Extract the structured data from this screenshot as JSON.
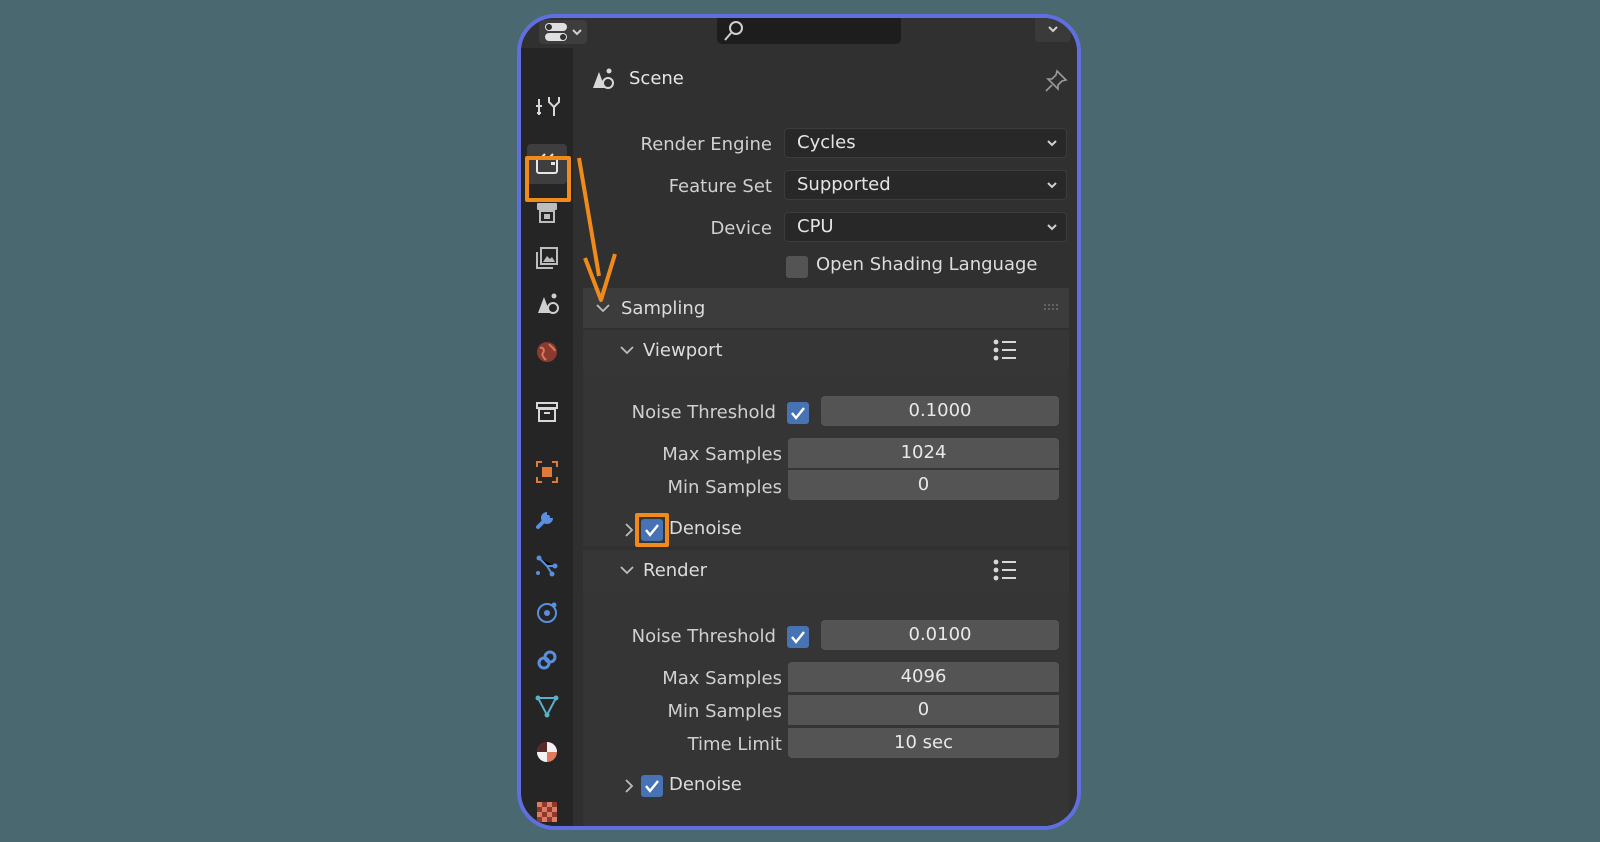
{
  "header": {
    "context_label": "Scene"
  },
  "render": {
    "engine_label": "Render Engine",
    "engine_value": "Cycles",
    "feature_set_label": "Feature Set",
    "feature_set_value": "Supported",
    "device_label": "Device",
    "device_value": "CPU",
    "osl_label": "Open Shading Language",
    "osl_checked": false
  },
  "sampling": {
    "title": "Sampling",
    "viewport": {
      "title": "Viewport",
      "noise_threshold_label": "Noise Threshold",
      "noise_threshold_enabled": true,
      "noise_threshold_value": "0.1000",
      "max_samples_label": "Max Samples",
      "max_samples_value": "1024",
      "min_samples_label": "Min Samples",
      "min_samples_value": "0",
      "denoise_label": "Denoise",
      "denoise_checked": true
    },
    "render": {
      "title": "Render",
      "noise_threshold_label": "Noise Threshold",
      "noise_threshold_enabled": true,
      "noise_threshold_value": "0.0100",
      "max_samples_label": "Max Samples",
      "max_samples_value": "4096",
      "min_samples_label": "Min Samples",
      "min_samples_value": "0",
      "time_limit_label": "Time Limit",
      "time_limit_value": "10 sec",
      "denoise_label": "Denoise",
      "denoise_checked": true
    }
  },
  "side_tabs": [
    {
      "name": "tool-icon"
    },
    {
      "name": "render-icon",
      "active": true
    },
    {
      "name": "output-icon"
    },
    {
      "name": "view-layer-icon"
    },
    {
      "name": "scene-icon"
    },
    {
      "name": "world-icon"
    },
    {
      "name": "collection-icon"
    },
    {
      "name": "object-icon"
    },
    {
      "name": "modifier-icon"
    },
    {
      "name": "particles-icon"
    },
    {
      "name": "physics-icon"
    },
    {
      "name": "constraints-icon"
    },
    {
      "name": "data-icon"
    },
    {
      "name": "material-icon"
    },
    {
      "name": "texture-icon"
    }
  ],
  "colors": {
    "accent": "#f08a1a",
    "frame_border": "#5f6fe0",
    "checkbox": "#4772b3"
  }
}
